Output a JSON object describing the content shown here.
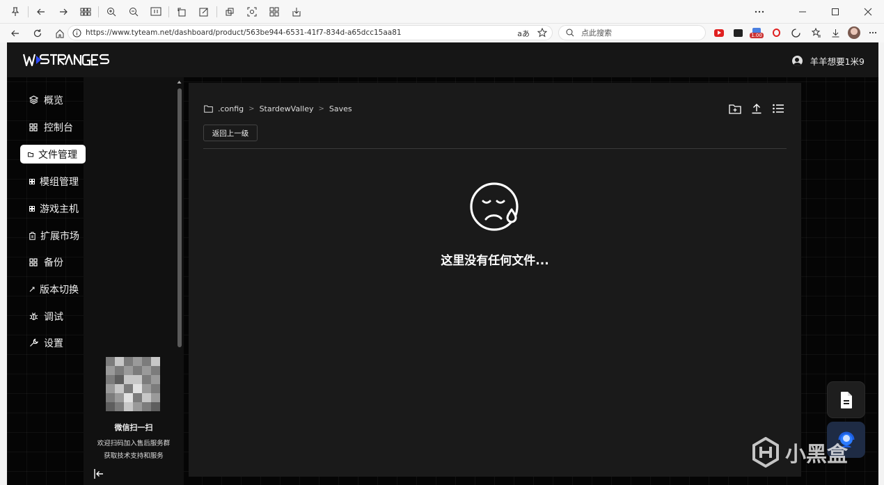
{
  "browser": {
    "url": "https://www.tyteam.net/dashboard/product/563be944-6531-41f7-834d-a65dcc15aa81",
    "search_placeholder": "点此搜索",
    "ext_badge": "1.00"
  },
  "header": {
    "logo_text": "WESTRANGES",
    "username": "羊羊想要1米9"
  },
  "sidebar": {
    "items": [
      {
        "label": "概览",
        "icon": "layers-icon"
      },
      {
        "label": "控制台",
        "icon": "grid-icon"
      },
      {
        "label": "文件管理",
        "icon": "folder-icon"
      },
      {
        "label": "模组管理",
        "icon": "grid-icon"
      },
      {
        "label": "游戏主机",
        "icon": "grid-icon"
      },
      {
        "label": "扩展市场",
        "icon": "store-icon"
      },
      {
        "label": "备份",
        "icon": "grid-icon"
      },
      {
        "label": "版本切换",
        "icon": "switch-icon"
      },
      {
        "label": "调试",
        "icon": "bug-icon"
      },
      {
        "label": "设置",
        "icon": "wrench-icon"
      }
    ],
    "active_index": 2,
    "qr_title": "微信扫一扫",
    "qr_line1": "欢迎扫码加入售后服务群",
    "qr_line2": "获取技术支持和服务"
  },
  "files": {
    "breadcrumb": [
      ".config",
      "StardewValley",
      "Saves"
    ],
    "back_label": "返回上一级",
    "empty_text": "这里没有任何文件..."
  },
  "watermark": "小黑盒"
}
